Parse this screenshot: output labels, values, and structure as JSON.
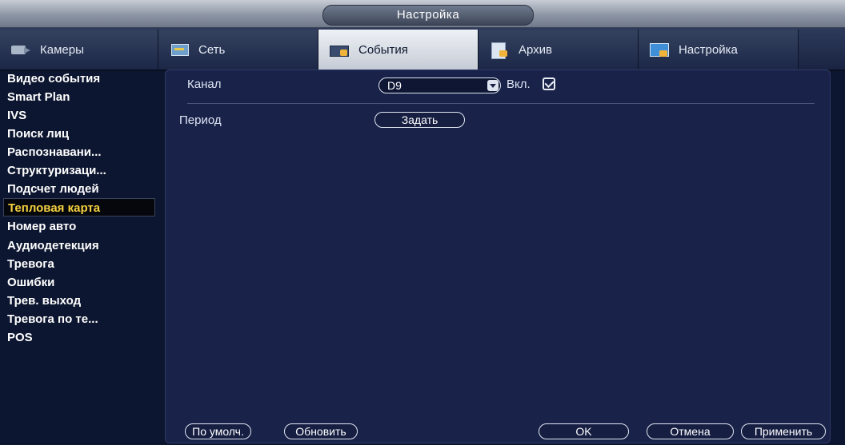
{
  "window": {
    "title": "Настройка"
  },
  "tabs": [
    {
      "label": "Камеры",
      "icon": "camera-icon"
    },
    {
      "label": "Сеть",
      "icon": "network-icon"
    },
    {
      "label": "События",
      "icon": "events-icon"
    },
    {
      "label": "Архив",
      "icon": "archive-icon"
    },
    {
      "label": "Настройка",
      "icon": "settings-icon"
    }
  ],
  "sidebar": {
    "items": [
      "Видео события",
      "Smart Plan",
      "IVS",
      "Поиск лиц",
      "Распознавани...",
      "Структуризаци...",
      "Подсчет людей",
      "Тепловая карта",
      "Номер авто",
      "Аудиодетекция",
      "Тревога",
      "Ошибки",
      "Трев. выход",
      "Тревога по те...",
      "POS"
    ],
    "active": "Тепловая карта"
  },
  "form": {
    "channel_label": "Канал",
    "channel_value": "D9",
    "enable_label": "Вкл.",
    "enabled": true,
    "period_label": "Период",
    "period_button": "Задать"
  },
  "footer": {
    "default_button": "По умолч.",
    "refresh_button": "Обновить",
    "ok_button": "OK",
    "cancel_button": "Отмена",
    "apply_button": "Применить"
  },
  "colors": {
    "active_accent": "#f4d03f",
    "panel_bg": "#192249"
  }
}
